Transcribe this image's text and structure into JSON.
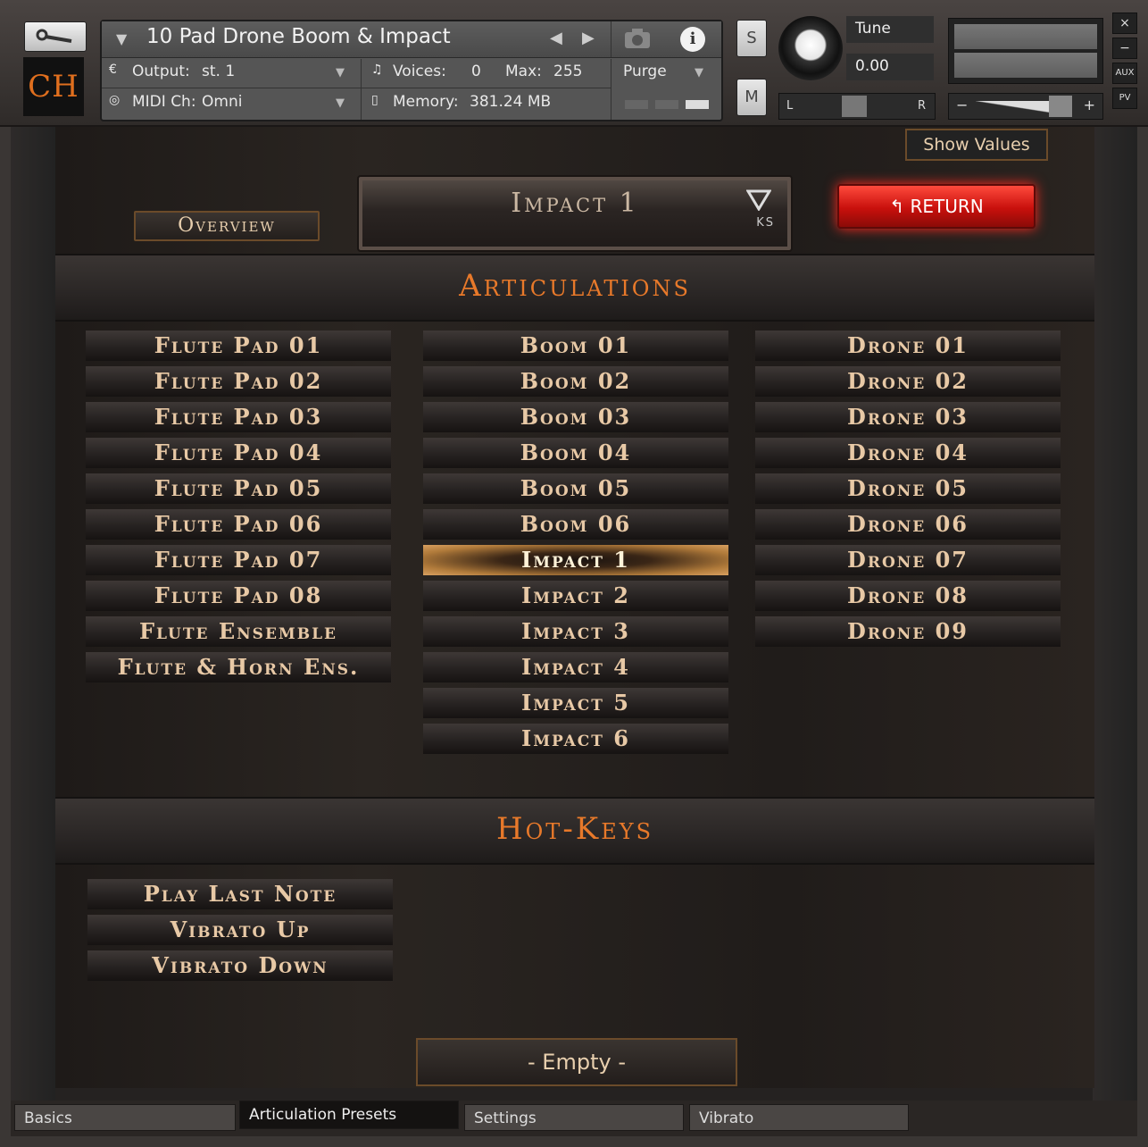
{
  "header": {
    "logo_text": "CH",
    "instrument_name": "10 Pad Drone Boom & Impact",
    "output_label": "Output:",
    "output_value": "st. 1",
    "voices_label": "Voices:",
    "voices_value": "0",
    "max_label": "Max:",
    "max_value": "255",
    "purge_label": "Purge",
    "midi_label": "MIDI Ch:",
    "midi_value": "Omni",
    "memory_label": "Memory:",
    "memory_value": "381.24 MB",
    "solo_label": "S",
    "mute_label": "M",
    "tune_label": "Tune",
    "tune_value": "0.00",
    "pan_left": "L",
    "pan_right": "R",
    "vol_minus": "−",
    "vol_plus": "+",
    "side_buttons": [
      "×",
      "−",
      "AUX",
      "PV"
    ]
  },
  "controls": {
    "show_values": "Show Values",
    "overview": "Overview",
    "selected_preset": "Impact 1",
    "ks_label": "KS",
    "return_label": "RETURN"
  },
  "articulations": {
    "title": "Articulations",
    "columns": [
      [
        "Flute Pad 01",
        "Flute Pad 02",
        "Flute Pad 03",
        "Flute Pad 04",
        "Flute Pad 05",
        "Flute Pad 06",
        "Flute Pad 07",
        "Flute Pad 08",
        "Flute Ensemble",
        "Flute & Horn Ens."
      ],
      [
        "Boom 01",
        "Boom 02",
        "Boom 03",
        "Boom 04",
        "Boom 05",
        "Boom 06",
        "Impact 1",
        "Impact 2",
        "Impact 3",
        "Impact 4",
        "Impact 5",
        "Impact 6"
      ],
      [
        "Drone 01",
        "Drone 02",
        "Drone 03",
        "Drone 04",
        "Drone 05",
        "Drone 06",
        "Drone 07",
        "Drone 08",
        "Drone 09"
      ]
    ],
    "selected": "Impact 1"
  },
  "hotkeys": {
    "title": "Hot-Keys",
    "items": [
      "Play Last Note",
      "Vibrato Up",
      "Vibrato Down"
    ]
  },
  "empty_slot": "- Empty -",
  "tabs": [
    {
      "label": "Basics",
      "active": false
    },
    {
      "label": "Articulation Presets",
      "active": true
    },
    {
      "label": "Settings",
      "active": false
    },
    {
      "label": "Vibrato",
      "active": false
    }
  ],
  "colors": {
    "accent_orange": "#e8792a",
    "button_text": "#e8c9a6",
    "return_red": "#d3140f"
  }
}
